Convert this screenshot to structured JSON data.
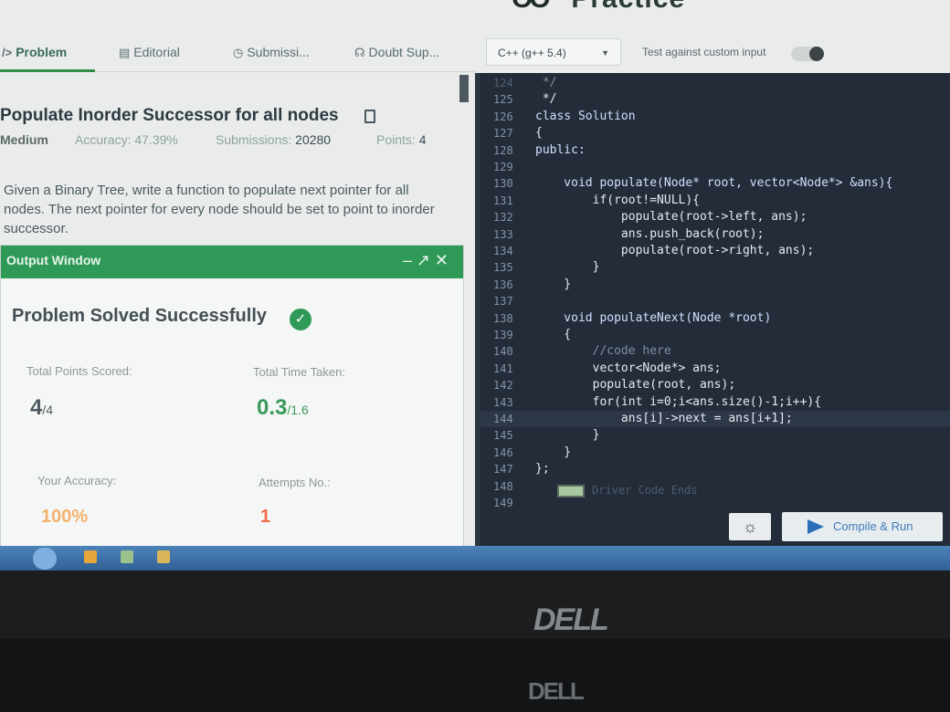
{
  "brand": {
    "text": "Practice"
  },
  "tabs": [
    {
      "label": "Problem",
      "icon": "code-icon"
    },
    {
      "label": "Editorial",
      "icon": "document-icon"
    },
    {
      "label": "Submissi...",
      "icon": "clock-icon"
    },
    {
      "label": "Doubt Sup...",
      "icon": "headset-icon"
    }
  ],
  "toolbar": {
    "language": "C++ (g++ 5.4)",
    "custom_input_label": "Test against custom input"
  },
  "problem": {
    "title": "Populate Inorder Successor for all nodes",
    "difficulty": "Medium",
    "accuracy_label": "Accuracy:",
    "accuracy_value": "47.39%",
    "submissions_label": "Submissions:",
    "submissions_value": "20280",
    "points_label": "Points:",
    "points_value": "4",
    "description": "Given a Binary Tree, write a function to populate next pointer for all nodes. The next pointer for every node should be set to point to inorder successor."
  },
  "output": {
    "title": "Output Window",
    "controls": "– ↗ ✕",
    "status": "Problem Solved Successfully",
    "points_label": "Total Points Scored:",
    "points_value": "4",
    "points_total": "/4",
    "time_label": "Total Time Taken:",
    "time_value": "0.3",
    "time_total": "/1.6",
    "accuracy_label": "Your Accuracy:",
    "accuracy_value": "100%",
    "attempts_label": "Attempts No.:",
    "attempts_value": "1"
  },
  "editor": {
    "lines": [
      {
        "n": "124",
        "t": " */"
      },
      {
        "n": "125",
        "t": " */"
      },
      {
        "n": "126",
        "t": "class Solution"
      },
      {
        "n": "127",
        "t": "{"
      },
      {
        "n": "128",
        "t": "public:"
      },
      {
        "n": "129",
        "t": ""
      },
      {
        "n": "130",
        "t": "    void populate(Node* root, vector<Node*> &ans){"
      },
      {
        "n": "131",
        "t": "        if(root!=NULL){"
      },
      {
        "n": "132",
        "t": "            populate(root->left, ans);"
      },
      {
        "n": "133",
        "t": "            ans.push_back(root);"
      },
      {
        "n": "134",
        "t": "            populate(root->right, ans);"
      },
      {
        "n": "135",
        "t": "        }"
      },
      {
        "n": "136",
        "t": "    }"
      },
      {
        "n": "137",
        "t": ""
      },
      {
        "n": "138",
        "t": "    void populateNext(Node *root)"
      },
      {
        "n": "139",
        "t": "    {"
      },
      {
        "n": "140",
        "t": "        //code here"
      },
      {
        "n": "141",
        "t": "        vector<Node*> ans;"
      },
      {
        "n": "142",
        "t": "        populate(root, ans);"
      },
      {
        "n": "143",
        "t": "        for(int i=0;i<ans.size()-1;i++){"
      },
      {
        "n": "144",
        "t": "            ans[i]->next = ans[i+1];"
      },
      {
        "n": "145",
        "t": "        }"
      },
      {
        "n": "146",
        "t": "    }"
      },
      {
        "n": "147",
        "t": "};"
      },
      {
        "n": "148",
        "t": ""
      },
      {
        "n": "149",
        "t": ""
      }
    ],
    "driver_ends": "Driver Code Ends"
  },
  "buttons": {
    "theme_icon": "☼",
    "compile_run": "Compile & Run"
  },
  "laptop": {
    "logo": "DELL",
    "logo_lower": "DELL"
  }
}
